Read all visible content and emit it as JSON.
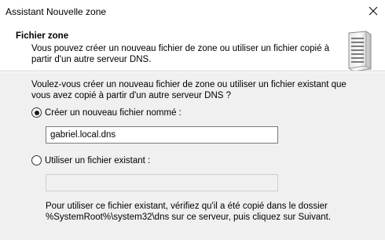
{
  "window": {
    "title": "Assistant Nouvelle zone"
  },
  "header": {
    "title": "Fichier zone",
    "description": "Vous pouvez créer un nouveau fichier de zone ou utiliser un fichier copié à partir d'un autre serveur DNS."
  },
  "body": {
    "question": "Voulez-vous créer un nouveau fichier de zone ou utiliser un fichier existant que vous avez copié à partir d'un autre serveur DNS ?",
    "option_new": {
      "label": "Créer un nouveau fichier nommé :",
      "checked": true,
      "value": "gabriel.local.dns"
    },
    "option_existing": {
      "label": "Utiliser un fichier existant :",
      "checked": false,
      "value": ""
    },
    "note": "Pour utiliser ce fichier existant, vérifiez qu'il a été copié dans le dossier %SystemRoot%\\system32\\dns sur ce serveur, puis cliquez sur Suivant."
  },
  "icons": {
    "close": "close-icon",
    "header_graphic": "server-icon"
  }
}
